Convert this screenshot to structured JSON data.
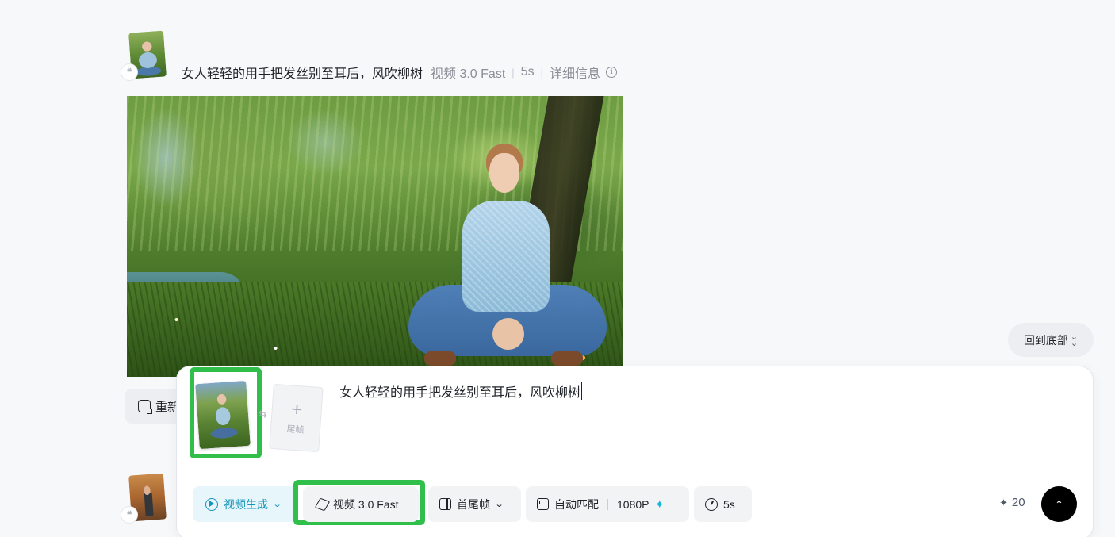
{
  "history": {
    "prompt": "女人轻轻的用手把发丝别至耳后，风吹柳树",
    "model": "视频 3.0 Fast",
    "duration": "5s",
    "details_label": "详细信息",
    "regenerate_label": "重新"
  },
  "back_to_bottom_label": "回到底部",
  "composer": {
    "last_frame_label": "尾帧",
    "prompt_value": "女人轻轻的用手把发丝别至耳后，风吹柳树",
    "toolbar": {
      "mode_label": "视频生成",
      "model_label": "视频 3.0 Fast",
      "frame_label": "首尾帧",
      "ratio_label": "自动匹配",
      "resolution_label": "1080P",
      "duration_label": "5s"
    },
    "credits": "20"
  },
  "icons": {
    "quote": "quote-icon",
    "info": "info-icon",
    "mode": "video-play-icon",
    "model": "cube-icon",
    "frame": "frame-icon",
    "ratio": "aspect-ratio-icon",
    "clock": "clock-icon",
    "spark": "sparkle-icon",
    "send": "arrow-up-icon"
  },
  "colors": {
    "highlight": "#2fbf4a",
    "accent": "#1595b8",
    "send_button": "#000000"
  }
}
